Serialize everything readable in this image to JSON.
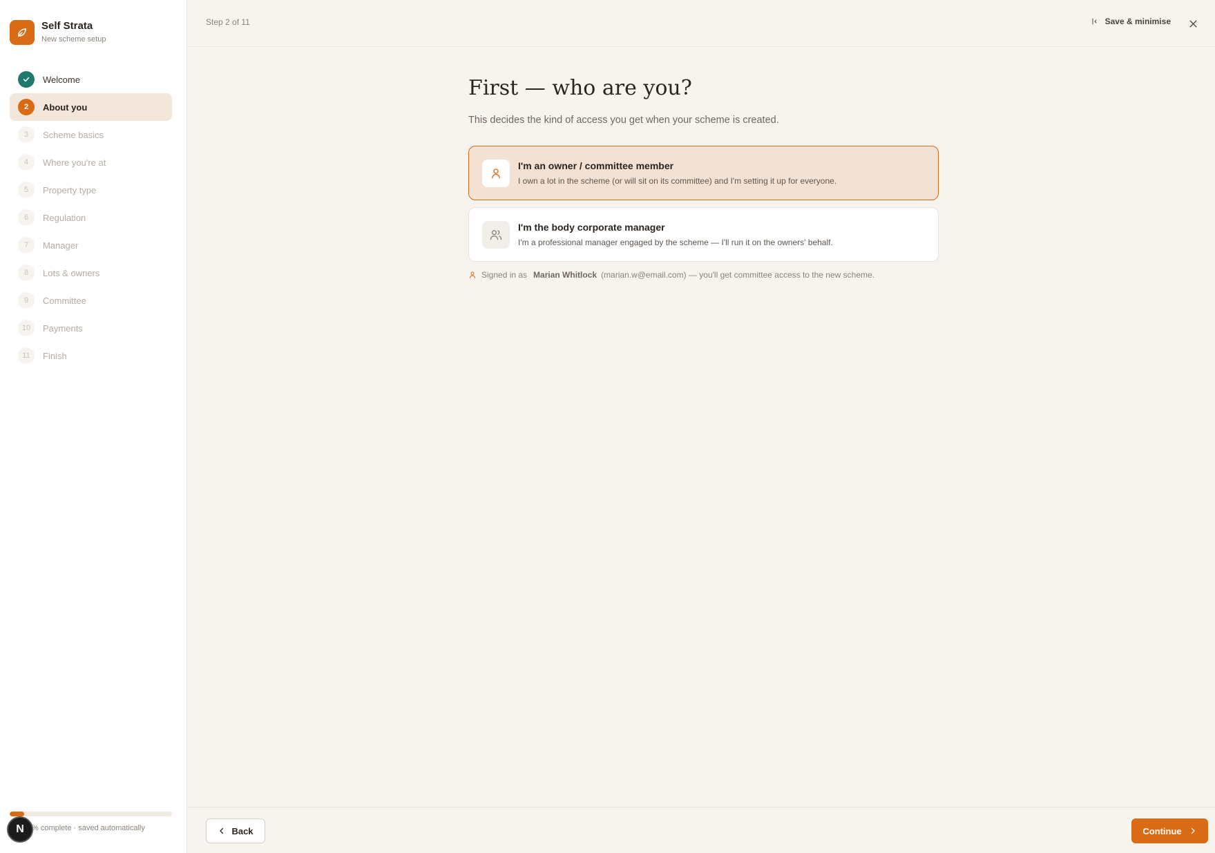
{
  "brand": {
    "name": "Self Strata",
    "subtitle": "New scheme setup",
    "logo_icon": "leaf-icon"
  },
  "sidebar": {
    "steps": [
      {
        "num": "",
        "label": "Welcome",
        "state": "done"
      },
      {
        "num": "2",
        "label": "About you",
        "state": "active"
      },
      {
        "num": "3",
        "label": "Scheme basics",
        "state": "upcoming"
      },
      {
        "num": "4",
        "label": "Where you're at",
        "state": "upcoming"
      },
      {
        "num": "5",
        "label": "Property type",
        "state": "upcoming"
      },
      {
        "num": "6",
        "label": "Regulation",
        "state": "upcoming"
      },
      {
        "num": "7",
        "label": "Manager",
        "state": "upcoming"
      },
      {
        "num": "8",
        "label": "Lots & owners",
        "state": "upcoming"
      },
      {
        "num": "9",
        "label": "Committee",
        "state": "upcoming"
      },
      {
        "num": "10",
        "label": "Payments",
        "state": "upcoming"
      },
      {
        "num": "11",
        "label": "Finish",
        "state": "upcoming"
      }
    ],
    "progress": {
      "fraction": 0.09,
      "text": "% complete · saved automatically"
    },
    "avatar_letter": "N"
  },
  "topbar": {
    "step_counter": "Step 2 of 11",
    "save_label": "Save & minimise"
  },
  "main": {
    "heading": "First — who are you?",
    "subheading": "This decides the kind of access you get when your scheme is created.",
    "options": [
      {
        "title": "I'm an owner / committee member",
        "description": "I own a lot in the scheme (or will sit on its committee) and I'm setting it up for everyone.",
        "icon": "person-icon",
        "selected": true
      },
      {
        "title": "I'm the body corporate manager",
        "description": "I'm a professional manager engaged by the scheme — I'll run it on the owners' behalf.",
        "icon": "people-icon",
        "selected": false
      }
    ],
    "signed_in": {
      "prefix": "Signed in as",
      "name": "Marian Whitlock",
      "suffix": "(marian.w@email.com) — you'll get committee access to the new scheme."
    }
  },
  "footer": {
    "back_label": "Back",
    "continue_label": "Continue"
  },
  "colors": {
    "accent": "#d96b16",
    "done": "#1f7a6d",
    "selected_bg": "#f3e2d4"
  }
}
